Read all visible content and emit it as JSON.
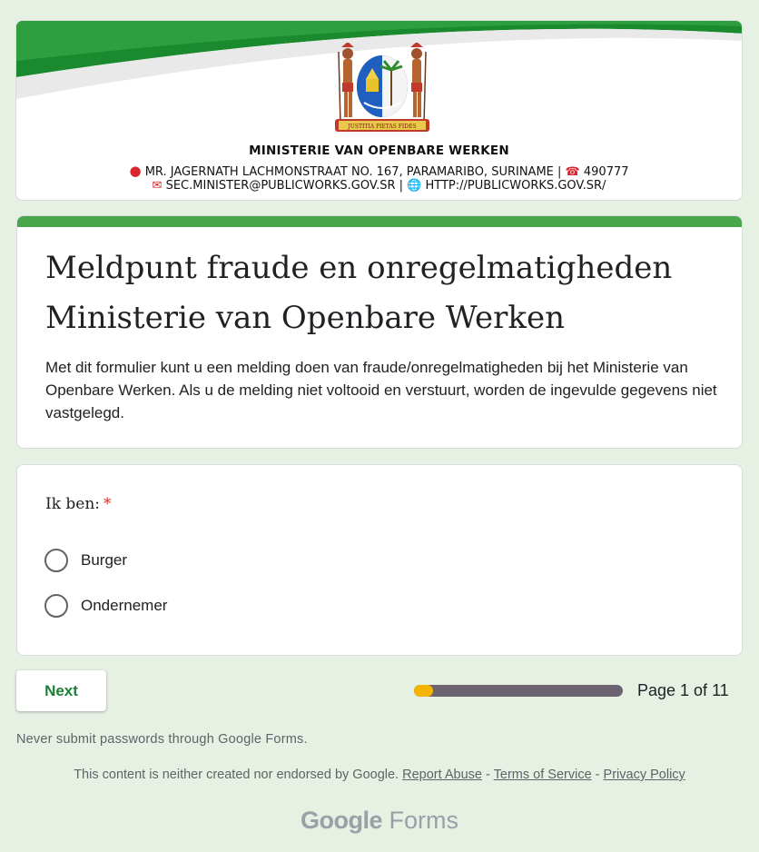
{
  "banner": {
    "ministry": "MINISTERIE VAN OPENBARE WERKEN",
    "address": "MR. JAGERNATH LACHMONSTRAAT NO. 167, PARAMARIBO, SURINAME |",
    "phone": "490777",
    "email": "SEC.MINISTER@PUBLICWORKS.GOV.SR |",
    "website": "HTTP://PUBLICWORKS.GOV.SR/",
    "coat_of_arms_motto": "JUSTITIA PIETAS FIDES",
    "icons": [
      "location-pin-icon",
      "phone-icon",
      "mail-icon",
      "globe-icon"
    ]
  },
  "form": {
    "title_line1": "Meldpunt fraude en onregelmatigheden",
    "title_line2": "Ministerie van Openbare Werken",
    "description": "Met dit formulier kunt u een melding doen van fraude/onregelmatigheden bij het Ministerie van Openbare Werken. Als u de melding niet voltooid en verstuurt, worden de ingevulde gegevens niet vastgelegd.",
    "accent_color": "#4aa64b"
  },
  "question": {
    "label": "Ik ben:",
    "required_mark": "*",
    "options": [
      "Burger",
      "Ondernemer"
    ]
  },
  "navigation": {
    "next_label": "Next",
    "progress_fraction": 0.0909,
    "page_text": "Page 1 of 11"
  },
  "footer": {
    "warning": "Never submit passwords through Google Forms.",
    "disclaimer": "This content is neither created nor endorsed by Google.",
    "report_abuse": "Report Abuse",
    "sep1": "-",
    "terms": "Terms of Service",
    "sep2": "-",
    "privacy": "Privacy Policy",
    "logo_google": "Google",
    "logo_forms": "Forms"
  }
}
